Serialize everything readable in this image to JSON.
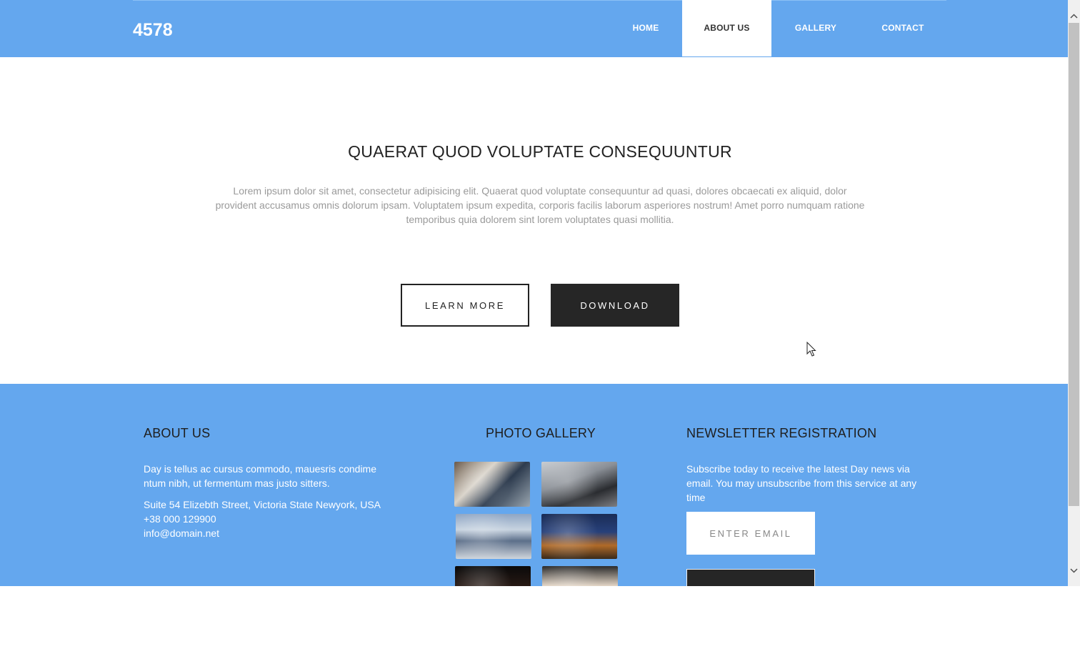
{
  "header": {
    "logo": "4578",
    "nav": [
      {
        "label": "HOME",
        "active": false
      },
      {
        "label": "ABOUT US",
        "active": true
      },
      {
        "label": "GALLERY",
        "active": false
      },
      {
        "label": "CONTACT",
        "active": false
      }
    ],
    "background_color": "#64a7ee"
  },
  "hero": {
    "title": "QUAERAT QUOD VOLUPTATE CONSEQUUNTUR",
    "text": "Lorem ipsum dolor sit amet, consectetur adipisicing elit. Quaerat quod voluptate consequuntur ad quasi, dolores obcaecati ex aliquid, dolor provident accusamus omnis dolorum ipsam. Voluptatem ipsum expedita, corporis facilis laborum asperiores nostrum! Amet porro numquam ratione temporibus quia dolorem sint lorem voluptates quasi mollitia.",
    "learn_more": "LEARN MORE",
    "download": "DOWNLOAD"
  },
  "footer": {
    "about": {
      "heading": "ABOUT US",
      "description": "Day is tellus ac cursus commodo, mauesris condime ntum nibh, ut fermentum mas justo sitters.",
      "address": "Suite 54 Elizebth Street, Victoria State Newyork, USA",
      "phone": "+38 000 129900",
      "email": "info@domain.net"
    },
    "gallery": {
      "heading": "PHOTO GALLERY",
      "thumbnails": [
        "photo-1",
        "photo-2",
        "photo-3",
        "photo-4",
        "photo-5",
        "photo-6"
      ]
    },
    "newsletter": {
      "heading": "NEWSLETTER REGISTRATION",
      "description": "Subscribe today to receive the latest Day news via email. You may unsubscribe from this service at any time",
      "email_placeholder": "ENTER EMAIL"
    }
  },
  "icons": {
    "scroll_up": "chevron-up-icon",
    "scroll_down": "chevron-down-icon",
    "cursor": "mouse-cursor-icon"
  }
}
